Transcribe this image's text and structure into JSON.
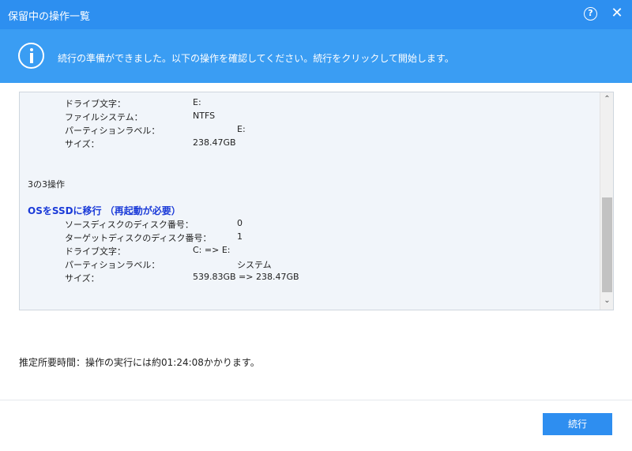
{
  "window": {
    "title": "保留中の操作一覧",
    "help_glyph": "?",
    "close_glyph": "✕"
  },
  "info": {
    "message": "続行の準備ができました。以下の操作を確認してください。続行をクリックして開始します。"
  },
  "operations": {
    "first_block": [
      {
        "label": "ドライブ文字：",
        "value": "E:"
      },
      {
        "label": "ファイルシステム：",
        "value": "NTFS"
      },
      {
        "label": "パーティションラベル：",
        "value": "E:"
      },
      {
        "label": "サイズ：",
        "value": "238.47GB"
      }
    ],
    "step_text": "3の3操作",
    "second_heading": "OSをSSDに移行 （再起動が必要）",
    "second_block": [
      {
        "label": "ソースディスクのディスク番号：",
        "value": "0"
      },
      {
        "label": "ターゲットディスクのディスク番号：",
        "value": "1"
      },
      {
        "label": "ドライブ文字：",
        "value": "C: => E:"
      },
      {
        "label": "パーティションラベル：",
        "value": "システム"
      },
      {
        "label": "サイズ：",
        "value": "539.83GB => 238.47GB"
      }
    ]
  },
  "scrollbar": {
    "up_glyph": "⌃",
    "down_glyph": "⌄"
  },
  "estimate": {
    "text": "推定所要時間：操作の実行には約01:24:08かかります。"
  },
  "buttons": {
    "continue_label": "続行"
  }
}
